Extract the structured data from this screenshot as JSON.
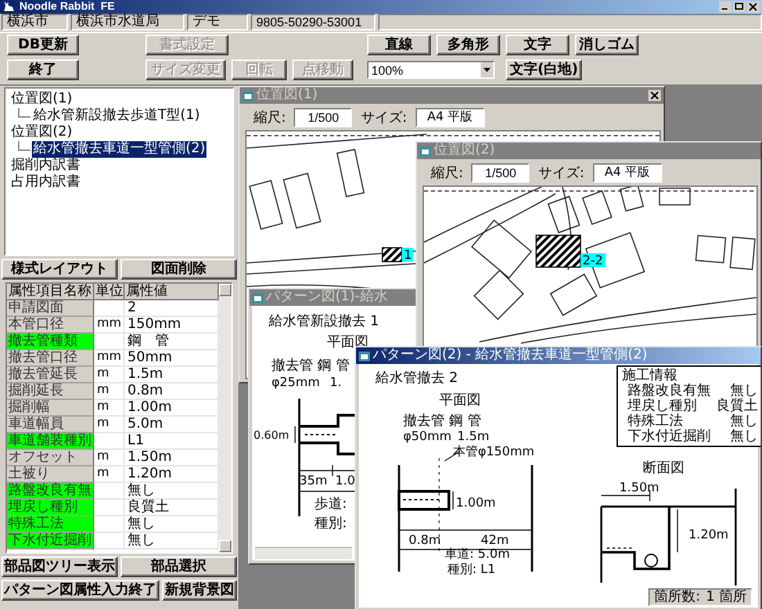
{
  "window": {
    "title": "Noodle Rabbit  FE"
  },
  "info_bar": [
    "横浜市",
    "横浜市水道局",
    "デモ",
    "9805-50290-53001"
  ],
  "toolbar": {
    "file": [
      {
        "label": "DB更新",
        "disabled": false
      },
      {
        "label": "終了",
        "disabled": false
      }
    ],
    "edit": [
      {
        "label": "書式設定",
        "disabled": true
      },
      {
        "label": "サイズ変更",
        "disabled": true
      },
      {
        "label": "回転",
        "disabled": true
      },
      {
        "label": "点移動",
        "disabled": true
      }
    ],
    "zoom": {
      "value": "100%"
    },
    "draw": [
      {
        "label": "直線",
        "disabled": false
      },
      {
        "label": "多角形",
        "disabled": false
      },
      {
        "label": "文字",
        "disabled": false
      },
      {
        "label": "消しゴム",
        "disabled": false
      },
      {
        "label": "文字(白地)",
        "disabled": false
      }
    ]
  },
  "tree": [
    {
      "label": "位置図(1)",
      "selected": false,
      "children": [
        {
          "label": "給水管新設撤去歩道T型(1)",
          "selected": false
        }
      ]
    },
    {
      "label": "位置図(2)",
      "selected": false,
      "children": [
        {
          "label": "給水管撤去車道一型管側(2)",
          "selected": true
        }
      ]
    },
    {
      "label": "掘削内訳書",
      "selected": false
    },
    {
      "label": "占用内訳書",
      "selected": false
    }
  ],
  "panel_buttons": [
    "様式レイアウト",
    "図面削除"
  ],
  "attributes": {
    "columns": [
      "属性項目名称",
      "単位",
      "属性値"
    ],
    "rows": [
      {
        "name": "申請図面",
        "unit": "",
        "value": "2",
        "highlighted": false
      },
      {
        "name": "本管口径",
        "unit": "mm",
        "value": "150mm",
        "highlighted": false
      },
      {
        "name": "撤去管種類",
        "unit": "",
        "value": "鋼　管",
        "highlighted": true
      },
      {
        "name": "撤去管口径",
        "unit": "mm",
        "value": "50mm",
        "highlighted": false
      },
      {
        "name": "撤去管延長",
        "unit": "m",
        "value": "1.5m",
        "highlighted": false
      },
      {
        "name": "掘削延長",
        "unit": "m",
        "value": "0.8m",
        "highlighted": false
      },
      {
        "name": "掘削幅",
        "unit": "m",
        "value": "1.00m",
        "highlighted": false
      },
      {
        "name": "車道幅員",
        "unit": "m",
        "value": "5.0m",
        "highlighted": false
      },
      {
        "name": "車道舗装種別",
        "unit": "",
        "value": "L1",
        "highlighted": true
      },
      {
        "name": "オフセット",
        "unit": "m",
        "value": "1.50m",
        "highlighted": false
      },
      {
        "name": "土被り",
        "unit": "m",
        "value": "1.20m",
        "highlighted": false
      },
      {
        "name": "路盤改良有無",
        "unit": "",
        "value": "無し",
        "highlighted": true
      },
      {
        "name": "埋戻し種別",
        "unit": "",
        "value": "良質土",
        "highlighted": true
      },
      {
        "name": "特殊工法",
        "unit": "",
        "value": "無し",
        "highlighted": true
      },
      {
        "name": "下水付近掘削",
        "unit": "",
        "value": "無し",
        "highlighted": true
      }
    ]
  },
  "bottom_buttons": [
    "部品図ツリー表示",
    "部品選択",
    "パターン図属性入力終了",
    "新規背景図"
  ],
  "windows": [
    {
      "kind": "map",
      "title": "位置図(1)",
      "active": false,
      "scale_label": "縮尺:",
      "scale": "1/500",
      "size_label": "サイズ:",
      "size": "A4 平版",
      "marker_label": "1"
    },
    {
      "kind": "plan",
      "title": "パターン図(1)-給水",
      "active": false,
      "labels": [
        "給水管新設撤去 1",
        "平面図",
        "撤去管 鋼 管",
        "φ25mm",
        "1.",
        "0.60m",
        "35m",
        "1.0",
        "歩道:",
        "種別:"
      ]
    },
    {
      "kind": "map",
      "title": "位置図(2)",
      "active": false,
      "scale_label": "縮尺:",
      "scale": "1/500",
      "size_label": "サイズ:",
      "size": "A4 平版",
      "marker_label": "2-2"
    },
    {
      "kind": "plan_section",
      "title": "パターン図(2) - 給水管撤去車道一型管側(2)",
      "active": true,
      "labels": [
        "給水管撤去 2",
        "平面図",
        "撤去管 鋼 管",
        "φ50mm",
        "1.5m",
        "本管φ150mm",
        "1.00m",
        "0.8m",
        "42m",
        "車道: 5.0m",
        "種別: L1",
        "断面図",
        "1.50m",
        "1.20m"
      ],
      "info": {
        "title": "施工情報",
        "rows": [
          {
            "name": "路盤改良有無",
            "value": "無し"
          },
          {
            "name": "埋戻し種別",
            "value": "良質土"
          },
          {
            "name": "特殊工法",
            "value": "無し"
          },
          {
            "name": "下水付近掘削",
            "value": "無し"
          }
        ]
      },
      "status": {
        "label": "箇所数:",
        "value": "1 箇所"
      }
    }
  ]
}
